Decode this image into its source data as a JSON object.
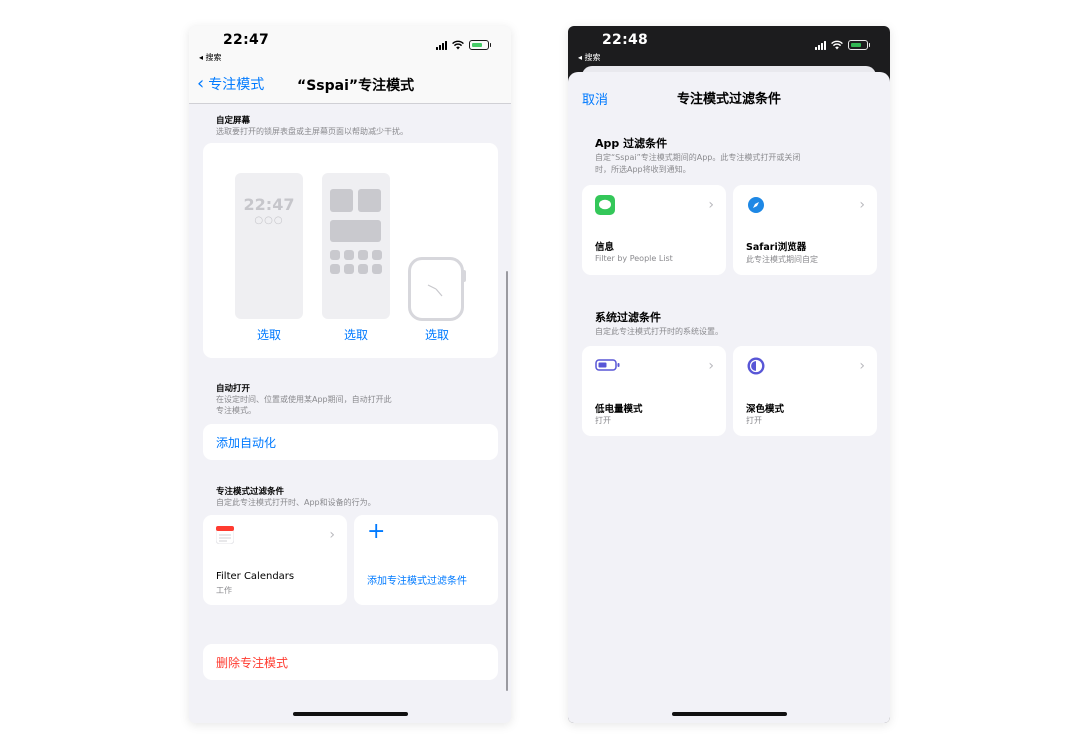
{
  "left": {
    "status": {
      "time": "22:47",
      "back_app": "◂ 搜索"
    },
    "nav": {
      "back_label": "专注模式",
      "title": "“Sspai”专注模式"
    },
    "custom_screen": {
      "title": "自定屏幕",
      "desc": "选取要打开的锁屏表盘或主屏幕页面以帮助减少干扰。",
      "lock_time": "22:47",
      "choose_labels": [
        "选取",
        "选取",
        "选取"
      ]
    },
    "auto_on": {
      "title": "自动打开",
      "desc_line1": "在设定时间、位置或使用某App期间，自动打开此",
      "desc_line2": "专注模式。",
      "add_label": "添加自动化"
    },
    "filters": {
      "title": "专注模式过滤条件",
      "desc": "自定此专注模式打开时、App和设备的行为。",
      "calendar_name": "Filter Calendars",
      "calendar_sub": "工作",
      "add_plus": "+",
      "add_label": "添加专注模式过滤条件"
    },
    "delete_label": "删除专注模式"
  },
  "right": {
    "status": {
      "time": "22:48",
      "back_app": "◂ 搜索"
    },
    "cancel_label": "取消",
    "title": "专注模式过滤条件",
    "app_filters": {
      "title": "App 过滤条件",
      "desc_line1": "自定“Sspai”专注模式期间的App。此专注模式打开或关闭",
      "desc_line2": "时，所选App将收到通知。",
      "items": [
        {
          "name": "信息",
          "sub": "Filter by People List",
          "icon": "messages-icon",
          "color": "#34c759"
        },
        {
          "name": "Safari浏览器",
          "sub": "此专注模式期间自定",
          "icon": "safari-icon",
          "color": "#1e88e5"
        }
      ]
    },
    "system_filters": {
      "title": "系统过滤条件",
      "desc": "自定此专注模式打开时的系统设置。",
      "items": [
        {
          "name": "低电量模式",
          "sub": "打开",
          "icon": "battery-icon",
          "color": "#5856d6"
        },
        {
          "name": "深色模式",
          "sub": "打开",
          "icon": "dark-mode-icon",
          "color": "#5856d6"
        }
      ]
    }
  }
}
